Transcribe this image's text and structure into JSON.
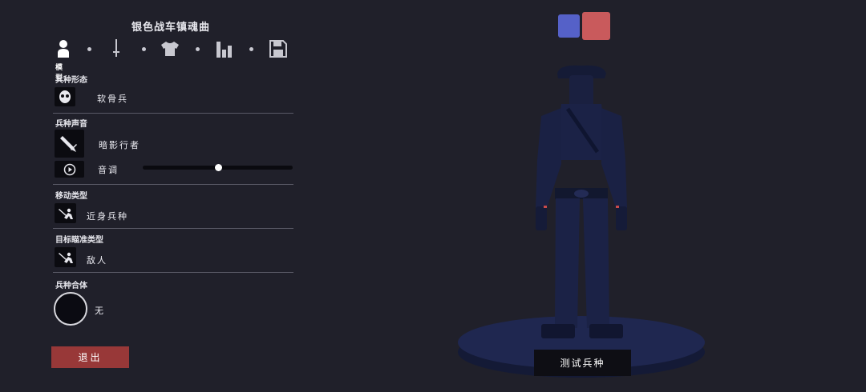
{
  "panel": {
    "title": "银色战车镇魂曲",
    "tabs": [
      {
        "icon": "person-icon",
        "label": "模型",
        "active": true
      },
      {
        "icon": "sword-icon"
      },
      {
        "icon": "shirt-icon"
      },
      {
        "icon": "bar-chart-icon"
      },
      {
        "icon": "save-icon"
      }
    ],
    "sections": {
      "form": {
        "label": "兵种形态",
        "value": "软骨兵",
        "icon": "mask-icon"
      },
      "voice": {
        "label": "兵种声音",
        "value": "暗影行者",
        "icon": "dagger-icon",
        "pitch_label": "音调",
        "pitch_value": 0.5,
        "play_icon": "play-icon"
      },
      "movement": {
        "label": "移动类型",
        "value": "近身兵种",
        "icon": "melee-unit-icon"
      },
      "targeting": {
        "label": "目标瞄准类型",
        "value": "敌人",
        "icon": "melee-unit-icon"
      },
      "fusion": {
        "label": "兵种合体",
        "value": "无"
      }
    },
    "exit_label": "退出"
  },
  "teams": [
    {
      "name": "blue-team",
      "color": "#5561c8"
    },
    {
      "name": "red-team",
      "color": "#c95a5c"
    }
  ],
  "test_button_label": "测试兵种",
  "colors": {
    "background": "#20202a",
    "exit": "#983838",
    "unit": "#1c2448"
  }
}
